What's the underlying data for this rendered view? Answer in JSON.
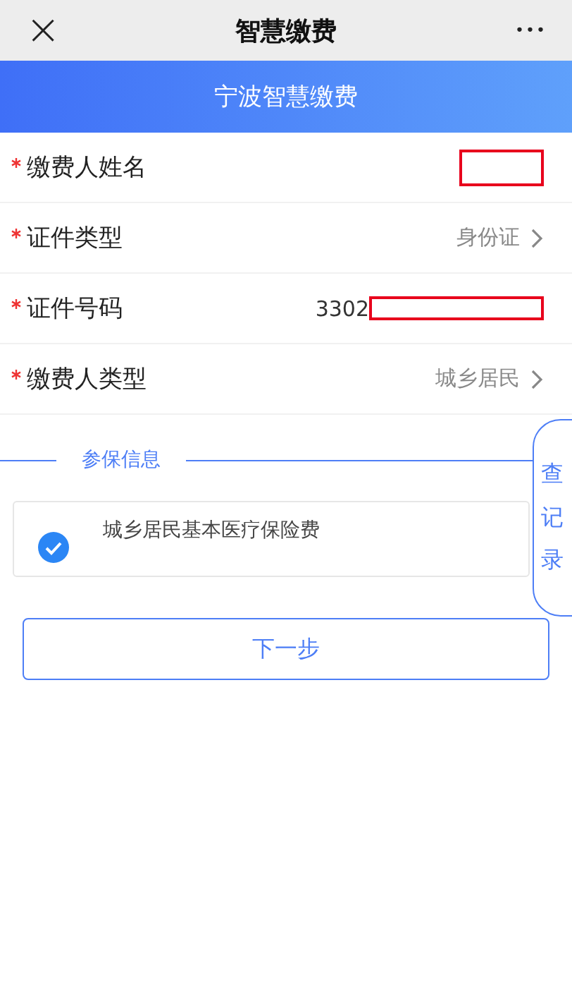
{
  "nav_bar": {
    "close_icon": "×",
    "title": "智慧缴费",
    "more": "•••"
  },
  "banner": {
    "title": "宁波智慧缴费"
  },
  "form_rows": [
    {
      "kind": "input",
      "required": true,
      "label": "缴费人姓名",
      "redacted": true
    },
    {
      "kind": "select",
      "required": true,
      "label": "证件类型",
      "value": "身份证"
    },
    {
      "kind": "input",
      "required": true,
      "label": "证件号码",
      "value": "3302",
      "redacted": true
    },
    {
      "kind": "select",
      "required": true,
      "label": "缴费人类型",
      "value": "城乡居民"
    }
  ],
  "section": {
    "title": "参保信息"
  },
  "insurance_items": [
    {
      "label": "城乡居民基本医疗保险费",
      "checked": true
    }
  ],
  "next_button": "下一步",
  "records_tab": "查记录"
}
